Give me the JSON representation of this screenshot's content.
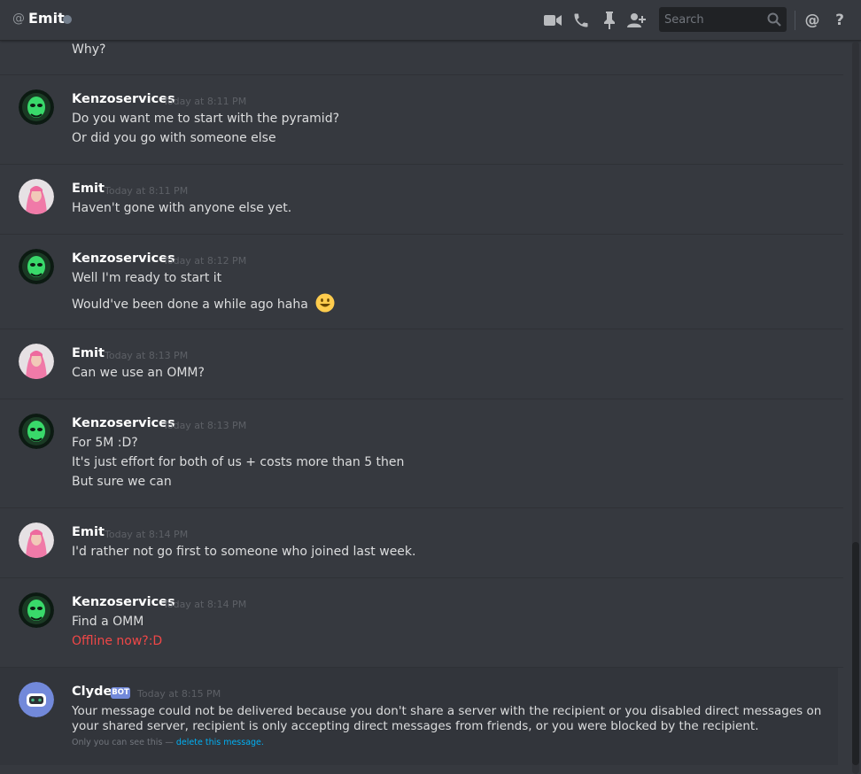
{
  "header": {
    "at_symbol": "@",
    "dm_name": "Emit",
    "status": "offline",
    "search_placeholder": "Search",
    "icons": [
      "video-call-icon",
      "phone-call-icon",
      "pin-icon",
      "add-friend-icon",
      "search-icon",
      "mentions-icon",
      "help-icon"
    ],
    "mention_glyph": "@",
    "help_glyph": "?"
  },
  "colors": {
    "background": "#36393f",
    "header_bg": "#36393f",
    "search_bg": "#202225",
    "bot_badge": "#7289da",
    "link": "#00b0f4",
    "error_text": "#f04747"
  },
  "messages": [
    {
      "author": "",
      "timestamp": "",
      "lines": [
        "Why?"
      ]
    },
    {
      "author": "Kenzoservices",
      "timestamp": "Today at 8:11 PM",
      "lines": [
        "Do you want me to start with the pyramid?",
        "Or did you go with someone else"
      ]
    },
    {
      "author": "Emit",
      "timestamp": "Today at 8:11 PM",
      "lines": [
        "Haven't gone with anyone else yet."
      ]
    },
    {
      "author": "Kenzoservices",
      "timestamp": "Today at 8:12 PM",
      "lines": [
        "Well I'm ready to start it",
        "Would've been done a while ago haha"
      ]
    },
    {
      "author": "Emit",
      "timestamp": "Today at 8:13 PM",
      "lines": [
        "Can we use an OMM?"
      ]
    },
    {
      "author": "Kenzoservices",
      "timestamp": "Today at 8:13 PM",
      "lines": [
        "For 5M :D?",
        "It's just effort for both of us + costs more than 5 then",
        "But sure we can"
      ]
    },
    {
      "author": "Emit",
      "timestamp": "Today at 8:14 PM",
      "lines": [
        "I'd rather not go first to someone who joined last week."
      ]
    },
    {
      "author": "Kenzoservices",
      "timestamp": "Today at 8:14 PM",
      "lines": [
        "Find a OMM",
        "Offline now?:D"
      ]
    }
  ],
  "clyde": {
    "author": "Clyde",
    "badge": "BOT",
    "timestamp": "Today at 8:15 PM",
    "body": "Your message could not be delivered because you don't share a server with the recipient or you disabled direct messages on your shared server, recipient is only accepting direct messages from friends, or you were blocked by the recipient.",
    "note_prefix": "Only you can see this —",
    "note_link": "delete this message."
  },
  "emoji": "smiley-face"
}
